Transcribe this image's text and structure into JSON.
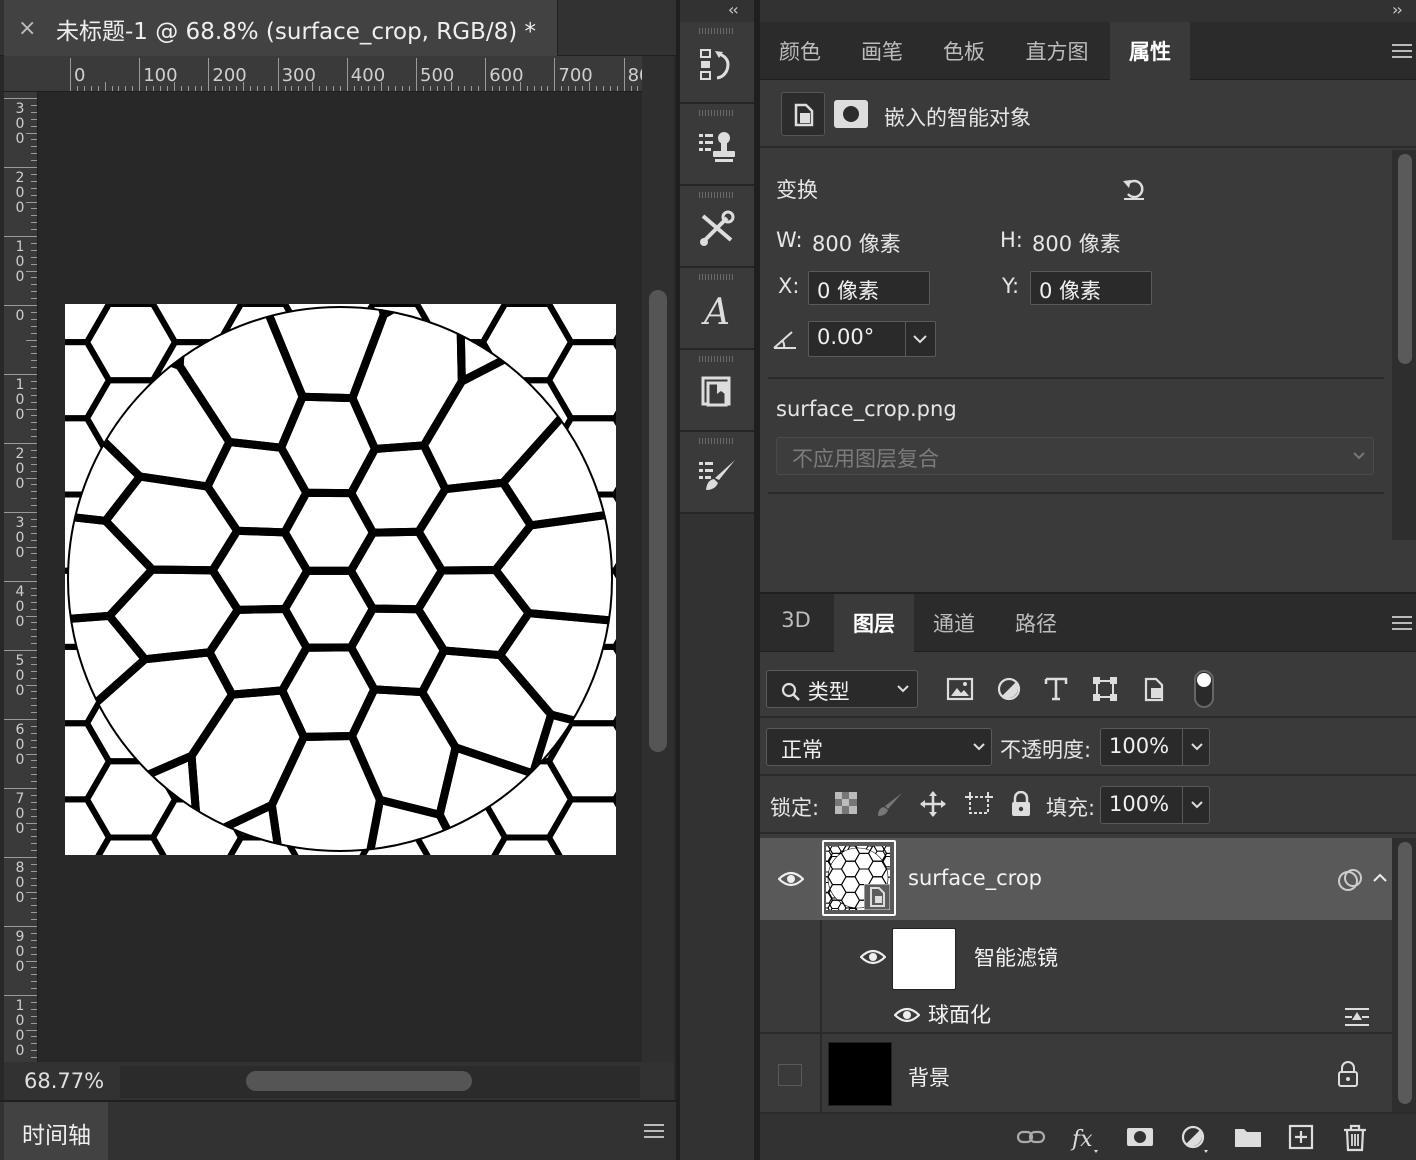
{
  "document": {
    "tab_title": "未标题-1 @ 68.8% (surface_crop, RGB/8) *",
    "close_glyph": "×",
    "zoom_level": "68.77%",
    "ruler_top_labels": [
      "0",
      "100",
      "200",
      "300",
      "400",
      "500",
      "600",
      "700",
      "80"
    ],
    "ruler_left_labels": [
      "300",
      "200",
      "100",
      "0",
      "100",
      "200",
      "300",
      "400",
      "500",
      "600",
      "700",
      "800",
      "900",
      "1000"
    ]
  },
  "timeline": {
    "label": "时间轴"
  },
  "panel_toggles": {
    "collapse_left": "‹‹",
    "collapse_right": "››"
  },
  "tools": [
    "history-panel-icon",
    "clone-source-icon",
    "tool-presets-icon",
    "character-style-icon",
    "libraries-icon",
    "brush-settings-icon"
  ],
  "properties": {
    "tabs": [
      "颜色",
      "画笔",
      "色板",
      "直方图",
      "属性"
    ],
    "active_tab": "属性",
    "object_type": "嵌入的智能对象",
    "transform_label": "变换",
    "w_label": "W:",
    "w_value": "800 像素",
    "h_label": "H:",
    "h_value": "800 像素",
    "x_label": "X:",
    "x_value": "0 像素",
    "y_label": "Y:",
    "y_value": "0 像素",
    "angle_value": "0.00°",
    "file_name": "surface_crop.png",
    "layer_comp_placeholder": "不应用图层复合"
  },
  "layers_panel": {
    "tabs": [
      "3D",
      "图层",
      "通道",
      "路径"
    ],
    "active_tab": "图层",
    "filter_type": "类型",
    "blend_mode": "正常",
    "opacity_label": "不透明度:",
    "opacity_value": "100%",
    "lock_label": "锁定:",
    "fill_label": "填充:",
    "fill_value": "100%",
    "layers": [
      {
        "name": "surface_crop",
        "visible": true,
        "selected": true
      },
      {
        "name": "智能滤镜",
        "visible": true
      },
      {
        "name": "球面化",
        "visible": true
      },
      {
        "name": "背景",
        "visible": false,
        "locked": true
      }
    ]
  },
  "colors": {
    "panel_bg": "#323232",
    "panel_light": "#3a3a3a",
    "selected_row": "#595959",
    "canvas_bg": "#282828"
  }
}
